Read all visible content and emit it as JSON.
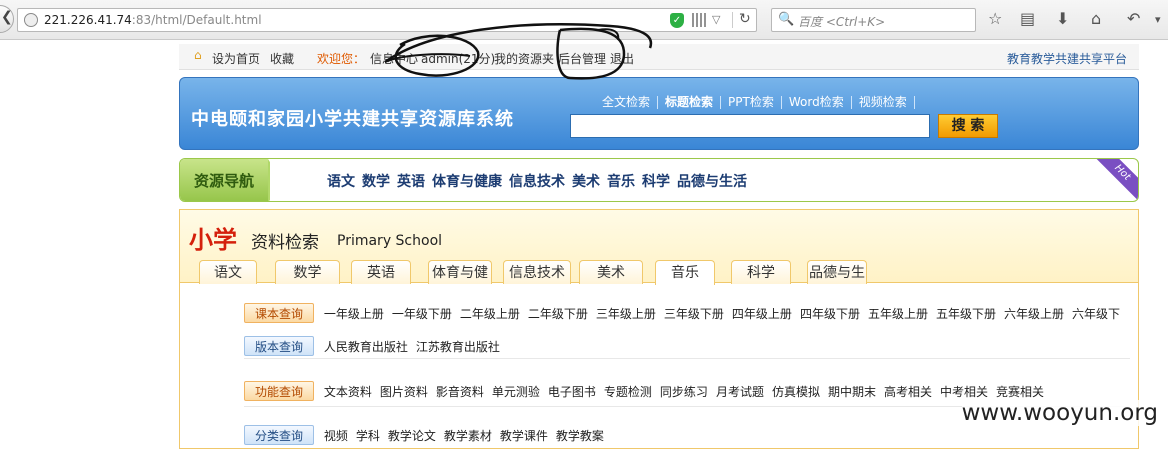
{
  "browser": {
    "url_main": "221.226.41.74",
    "url_port_path": ":83/html/Default.html",
    "search_placeholder": "百度 <Ctrl+K>",
    "back_glyph": "❮",
    "reload_glyph": "↻",
    "dropdown_glyph": "▽",
    "search_glyph": "🔍",
    "shield_glyph": "✓",
    "icons": [
      "star-icon",
      "reading-list-icon",
      "download-icon",
      "home-icon",
      "undo-icon"
    ]
  },
  "top_strip": {
    "set_homepage": "设为首页",
    "favorite": "收藏",
    "welcome": "欢迎您：",
    "info_center": "信息中心",
    "user": "admin(21分)",
    "my_resources": "我的资源夹",
    "admin_panel": "后台管理",
    "logout": "退出",
    "platform": "教育教学共建共享平台"
  },
  "banner": {
    "title": "中电颐和家园小学共建共享资源库系统",
    "search_tabs": [
      {
        "label": "全文检索",
        "active": false
      },
      {
        "label": "标题检索",
        "active": true
      },
      {
        "label": "PPT检索",
        "active": false
      },
      {
        "label": "Word检索",
        "active": false
      },
      {
        "label": "视频检索",
        "active": false
      }
    ],
    "search_value": "",
    "search_button": "搜 索"
  },
  "nav": {
    "head": "资源导航",
    "items": [
      "语文",
      "数学",
      "英语",
      "体育与健康",
      "信息技术",
      "美术",
      "音乐",
      "科学",
      "品德与生活"
    ],
    "hot": "Hot"
  },
  "panel": {
    "title_main": "小学",
    "title_sub": "资料检索",
    "title_en": "Primary School",
    "tabs": [
      {
        "label": "语文",
        "active": false
      },
      {
        "label": "数学",
        "active": false
      },
      {
        "label": "英语",
        "active": false
      },
      {
        "label": "体育与健",
        "active": false
      },
      {
        "label": "信息技术",
        "active": false
      },
      {
        "label": "美术",
        "active": false
      },
      {
        "label": "音乐",
        "active": true
      },
      {
        "label": "科学",
        "active": false
      },
      {
        "label": "品德与生",
        "active": false
      }
    ],
    "rows": [
      {
        "label": "课本查询",
        "style": "orange",
        "links": [
          "一年级上册",
          "一年级下册",
          "二年级上册",
          "二年级下册",
          "三年级上册",
          "三年级下册",
          "四年级上册",
          "四年级下册",
          "五年级上册",
          "五年级下册",
          "六年级上册",
          "六年级下"
        ]
      },
      {
        "label": "版本查询",
        "style": "blue",
        "links": [
          "人民教育出版社",
          "江苏教育出版社"
        ]
      },
      {
        "label": "功能查询",
        "style": "orange",
        "links": [
          "文本资料",
          "图片资料",
          "影音资料",
          "单元测验",
          "电子图书",
          "专题检测",
          "同步练习",
          "月考试题",
          "仿真模拟",
          "期中期末",
          "高考相关",
          "中考相关",
          "竞赛相关"
        ]
      },
      {
        "label": "分类查询",
        "style": "blue",
        "links": [
          "视频",
          "学科",
          "教学论文",
          "教学素材",
          "教学课件",
          "教学教案"
        ]
      }
    ]
  },
  "watermark": "www.wooyun.org"
}
